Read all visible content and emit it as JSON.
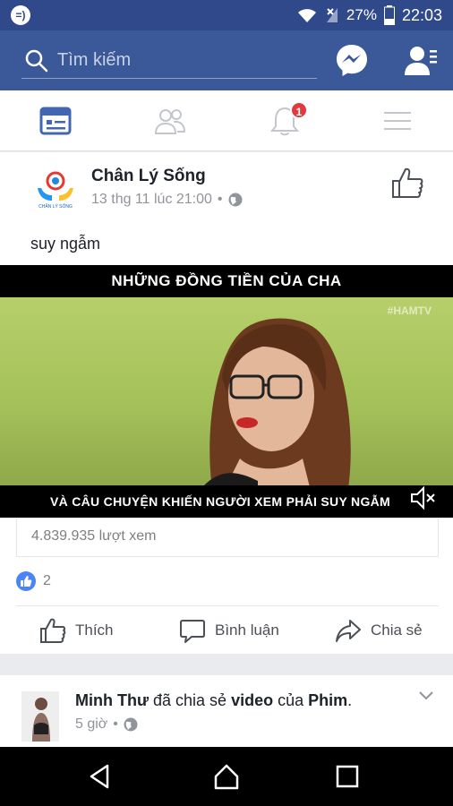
{
  "status_bar": {
    "battery": "27%",
    "time": "22:03"
  },
  "search": {
    "placeholder": "Tìm kiếm"
  },
  "tabs": [
    {
      "name": "news-feed",
      "icon": "news-feed-icon",
      "active": true
    },
    {
      "name": "friends",
      "icon": "friends-icon"
    },
    {
      "name": "notifications",
      "icon": "bell-icon",
      "badge": "1"
    },
    {
      "name": "menu",
      "icon": "hamburger-icon"
    }
  ],
  "post": {
    "page_name": "Chân Lý Sống",
    "avatar_text": "CHÂN LÝ SỐNG",
    "timestamp": "13 thg 11 lúc 21:00",
    "separator": "•",
    "text": "suy ngẫm",
    "video": {
      "top_caption": "NHỮNG ĐỒNG TIỀN CỦA CHA",
      "bottom_caption": "VÀ CÂU CHUYỆN KHIẾN NGƯỜI XEM PHẢI SUY NGẪM",
      "watermark": "#HAMTV"
    },
    "views": "4.839.935 lượt xem",
    "like_count": "2",
    "actions": {
      "like": "Thích",
      "comment": "Bình luận",
      "share": "Chia sẻ"
    }
  },
  "post2": {
    "user": "Minh Thư",
    "mid1": " đã chia sẻ ",
    "object": "video",
    "mid2": " của ",
    "target": "Phim",
    "end": ".",
    "time": "5 giờ",
    "separator": "•"
  },
  "colors": {
    "brand": "#3b5998",
    "statusbar": "#30498a",
    "badge": "#e0393e",
    "like_blue": "#4a84f7"
  }
}
